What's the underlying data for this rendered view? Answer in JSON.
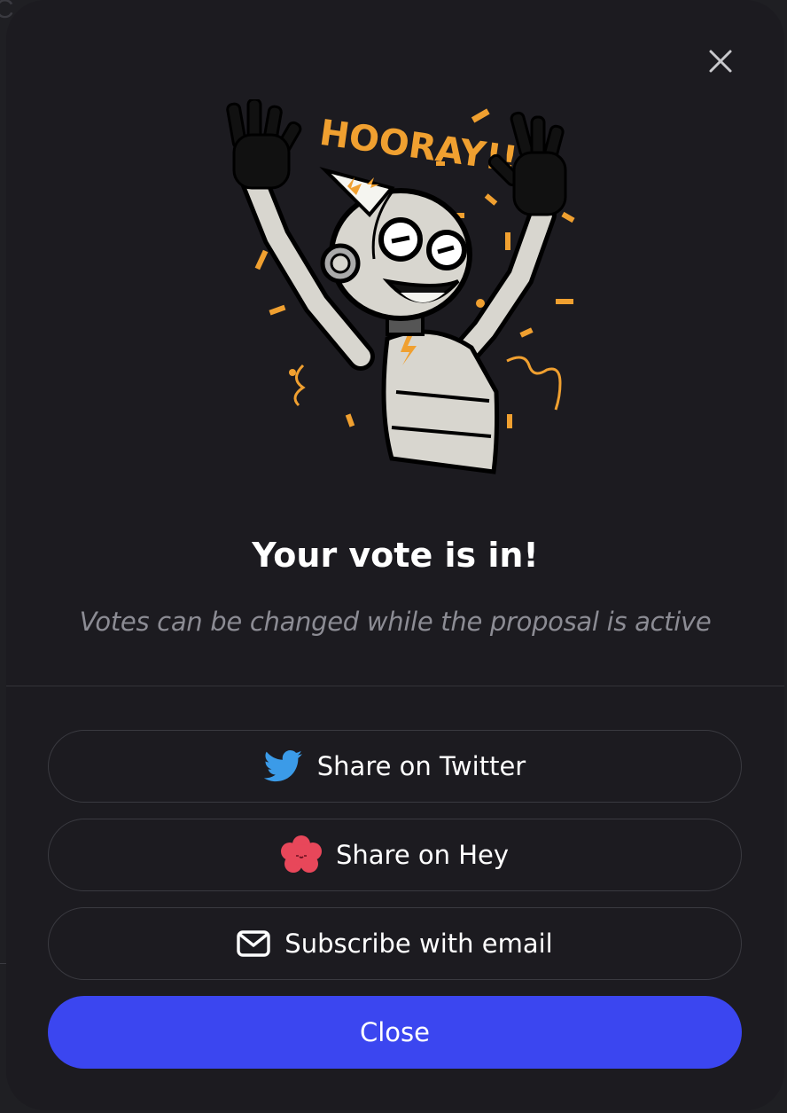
{
  "modal": {
    "close_icon": "close-icon",
    "illustration": {
      "name": "celebrating-robot-illustration",
      "banner_text": "HOORAY!!",
      "accent_color": "#f0a030"
    },
    "title": "Your vote is in!",
    "subtitle": "Votes can be changed while the proposal is active",
    "buttons": [
      {
        "label": "Share on Twitter",
        "icon": "twitter-bird-icon",
        "icon_color": "#3b9be8"
      },
      {
        "label": "Share on Hey",
        "icon": "hey-flower-icon",
        "icon_color": "#e8475a"
      },
      {
        "label": "Subscribe with email",
        "icon": "envelope-icon",
        "icon_color": "#ffffff"
      }
    ],
    "close_button": {
      "label": "Close",
      "color": "#3b46f0"
    }
  }
}
